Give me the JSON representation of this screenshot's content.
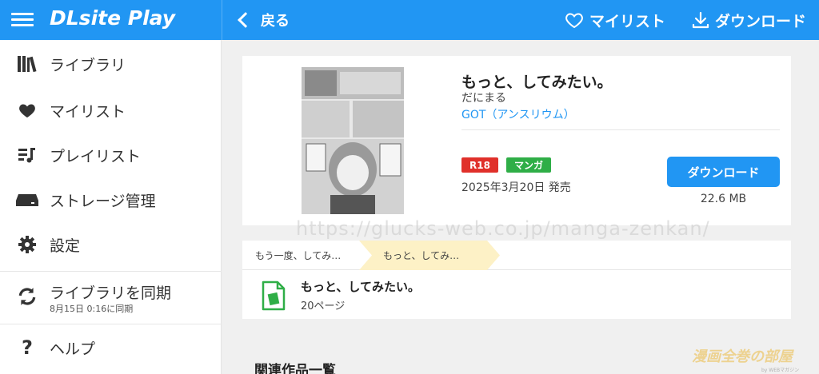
{
  "header": {
    "logo": "DLsite Play",
    "back_label": "戻る",
    "mylist_label": "マイリスト",
    "download_label": "ダウンロード"
  },
  "sidebar": {
    "items": [
      {
        "label": "ライブラリ",
        "icon": "library-icon"
      },
      {
        "label": "マイリスト",
        "icon": "heart-icon"
      },
      {
        "label": "プレイリスト",
        "icon": "playlist-icon"
      },
      {
        "label": "ストレージ管理",
        "icon": "storage-icon"
      },
      {
        "label": "設定",
        "icon": "gear-icon"
      },
      {
        "label": "ライブラリを同期",
        "icon": "sync-icon",
        "sub": "8月15日 0:16に同期"
      },
      {
        "label": "ヘルプ",
        "icon": "help-icon"
      }
    ]
  },
  "product": {
    "title": "もっと、してみたい。",
    "author": "だにまる",
    "circle": "GOT（アンスリウム）",
    "badges": [
      "R18",
      "マンガ"
    ],
    "release": "2025年3月20日 発売",
    "download_button": "ダウンロード",
    "filesize": "22.6 MB"
  },
  "breadcrumbs": [
    "もう一度、してみ…",
    "もっと、してみ…"
  ],
  "volume": {
    "title": "もっと、してみたい。",
    "pages": "20ページ"
  },
  "related_heading": "関連作品一覧",
  "watermark": {
    "url": "https://glucks-web.co.jp/manga-zenkan/",
    "logo": "漫画全巻の部屋",
    "logo_sub": "by WEBマガジン"
  },
  "colors": {
    "accent": "#2196f3",
    "r18": "#e0302a",
    "manga": "#2fae47",
    "crumb_active": "#fdf1c6"
  }
}
